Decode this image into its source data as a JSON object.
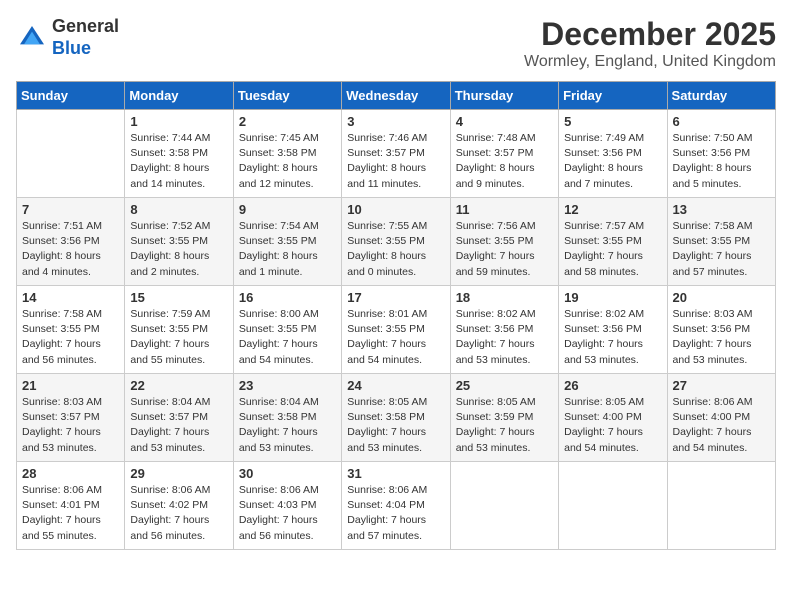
{
  "header": {
    "logo": {
      "general": "General",
      "blue": "Blue"
    },
    "title": "December 2025",
    "subtitle": "Wormley, England, United Kingdom"
  },
  "columns": [
    "Sunday",
    "Monday",
    "Tuesday",
    "Wednesday",
    "Thursday",
    "Friday",
    "Saturday"
  ],
  "weeks": [
    [
      {
        "day": "",
        "info": ""
      },
      {
        "day": "1",
        "info": "Sunrise: 7:44 AM\nSunset: 3:58 PM\nDaylight: 8 hours\nand 14 minutes."
      },
      {
        "day": "2",
        "info": "Sunrise: 7:45 AM\nSunset: 3:58 PM\nDaylight: 8 hours\nand 12 minutes."
      },
      {
        "day": "3",
        "info": "Sunrise: 7:46 AM\nSunset: 3:57 PM\nDaylight: 8 hours\nand 11 minutes."
      },
      {
        "day": "4",
        "info": "Sunrise: 7:48 AM\nSunset: 3:57 PM\nDaylight: 8 hours\nand 9 minutes."
      },
      {
        "day": "5",
        "info": "Sunrise: 7:49 AM\nSunset: 3:56 PM\nDaylight: 8 hours\nand 7 minutes."
      },
      {
        "day": "6",
        "info": "Sunrise: 7:50 AM\nSunset: 3:56 PM\nDaylight: 8 hours\nand 5 minutes."
      }
    ],
    [
      {
        "day": "7",
        "info": "Sunrise: 7:51 AM\nSunset: 3:56 PM\nDaylight: 8 hours\nand 4 minutes."
      },
      {
        "day": "8",
        "info": "Sunrise: 7:52 AM\nSunset: 3:55 PM\nDaylight: 8 hours\nand 2 minutes."
      },
      {
        "day": "9",
        "info": "Sunrise: 7:54 AM\nSunset: 3:55 PM\nDaylight: 8 hours\nand 1 minute."
      },
      {
        "day": "10",
        "info": "Sunrise: 7:55 AM\nSunset: 3:55 PM\nDaylight: 8 hours\nand 0 minutes."
      },
      {
        "day": "11",
        "info": "Sunrise: 7:56 AM\nSunset: 3:55 PM\nDaylight: 7 hours\nand 59 minutes."
      },
      {
        "day": "12",
        "info": "Sunrise: 7:57 AM\nSunset: 3:55 PM\nDaylight: 7 hours\nand 58 minutes."
      },
      {
        "day": "13",
        "info": "Sunrise: 7:58 AM\nSunset: 3:55 PM\nDaylight: 7 hours\nand 57 minutes."
      }
    ],
    [
      {
        "day": "14",
        "info": "Sunrise: 7:58 AM\nSunset: 3:55 PM\nDaylight: 7 hours\nand 56 minutes."
      },
      {
        "day": "15",
        "info": "Sunrise: 7:59 AM\nSunset: 3:55 PM\nDaylight: 7 hours\nand 55 minutes."
      },
      {
        "day": "16",
        "info": "Sunrise: 8:00 AM\nSunset: 3:55 PM\nDaylight: 7 hours\nand 54 minutes."
      },
      {
        "day": "17",
        "info": "Sunrise: 8:01 AM\nSunset: 3:55 PM\nDaylight: 7 hours\nand 54 minutes."
      },
      {
        "day": "18",
        "info": "Sunrise: 8:02 AM\nSunset: 3:56 PM\nDaylight: 7 hours\nand 53 minutes."
      },
      {
        "day": "19",
        "info": "Sunrise: 8:02 AM\nSunset: 3:56 PM\nDaylight: 7 hours\nand 53 minutes."
      },
      {
        "day": "20",
        "info": "Sunrise: 8:03 AM\nSunset: 3:56 PM\nDaylight: 7 hours\nand 53 minutes."
      }
    ],
    [
      {
        "day": "21",
        "info": "Sunrise: 8:03 AM\nSunset: 3:57 PM\nDaylight: 7 hours\nand 53 minutes."
      },
      {
        "day": "22",
        "info": "Sunrise: 8:04 AM\nSunset: 3:57 PM\nDaylight: 7 hours\nand 53 minutes."
      },
      {
        "day": "23",
        "info": "Sunrise: 8:04 AM\nSunset: 3:58 PM\nDaylight: 7 hours\nand 53 minutes."
      },
      {
        "day": "24",
        "info": "Sunrise: 8:05 AM\nSunset: 3:58 PM\nDaylight: 7 hours\nand 53 minutes."
      },
      {
        "day": "25",
        "info": "Sunrise: 8:05 AM\nSunset: 3:59 PM\nDaylight: 7 hours\nand 53 minutes."
      },
      {
        "day": "26",
        "info": "Sunrise: 8:05 AM\nSunset: 4:00 PM\nDaylight: 7 hours\nand 54 minutes."
      },
      {
        "day": "27",
        "info": "Sunrise: 8:06 AM\nSunset: 4:00 PM\nDaylight: 7 hours\nand 54 minutes."
      }
    ],
    [
      {
        "day": "28",
        "info": "Sunrise: 8:06 AM\nSunset: 4:01 PM\nDaylight: 7 hours\nand 55 minutes."
      },
      {
        "day": "29",
        "info": "Sunrise: 8:06 AM\nSunset: 4:02 PM\nDaylight: 7 hours\nand 56 minutes."
      },
      {
        "day": "30",
        "info": "Sunrise: 8:06 AM\nSunset: 4:03 PM\nDaylight: 7 hours\nand 56 minutes."
      },
      {
        "day": "31",
        "info": "Sunrise: 8:06 AM\nSunset: 4:04 PM\nDaylight: 7 hours\nand 57 minutes."
      },
      {
        "day": "",
        "info": ""
      },
      {
        "day": "",
        "info": ""
      },
      {
        "day": "",
        "info": ""
      }
    ]
  ]
}
